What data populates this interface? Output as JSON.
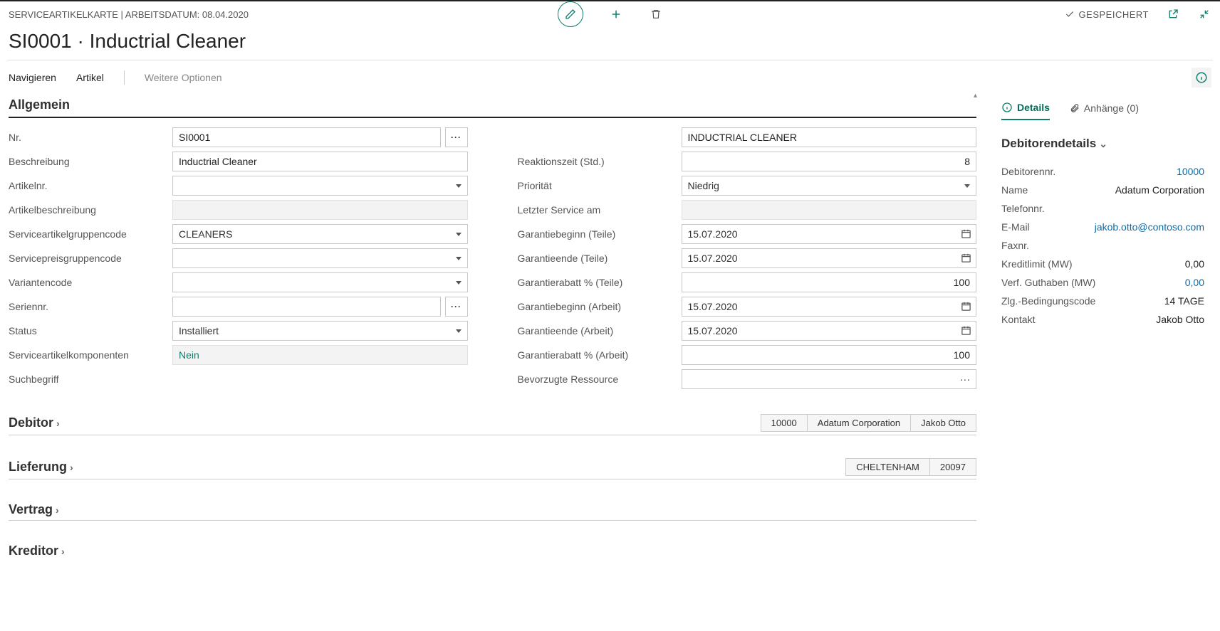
{
  "header": {
    "breadcrumb": "SERVICEARTIKELKARTE | ARBEITSDATUM: 08.04.2020",
    "saved_label": "GESPEICHERT",
    "title": "SI0001 · Inductrial Cleaner"
  },
  "menubar": {
    "navigieren": "Navigieren",
    "artikel": "Artikel",
    "weitere": "Weitere Optionen"
  },
  "general": {
    "title": "Allgemein",
    "labels": {
      "nr": "Nr.",
      "beschreibung": "Beschreibung",
      "artikelnr": "Artikelnr.",
      "artikelbeschreibung": "Artikelbeschreibung",
      "serviceartikelgruppencode": "Serviceartikelgruppencode",
      "servicepreisgruppencode": "Servicepreisgruppencode",
      "variantencode": "Variantencode",
      "seriennr": "Seriennr.",
      "status": "Status",
      "serviceartikelkomponenten": "Serviceartikelkomponenten",
      "suchbegriff": "Suchbegriff",
      "blank": "",
      "reaktionszeit": "Reaktionszeit (Std.)",
      "prioritaet": "Priorität",
      "letzter_service": "Letzter Service am",
      "garantiebeginn_teile": "Garantiebeginn (Teile)",
      "garantieende_teile": "Garantieende (Teile)",
      "garantierabatt_teile": "Garantierabatt % (Teile)",
      "garantiebeginn_arbeit": "Garantiebeginn (Arbeit)",
      "garantieende_arbeit": "Garantieende (Arbeit)",
      "garantierabatt_arbeit": "Garantierabatt % (Arbeit)",
      "bevorzugte_ressource": "Bevorzugte Ressource"
    },
    "values": {
      "nr": "SI0001",
      "beschreibung": "Inductrial Cleaner",
      "artikelnr": "",
      "artikelbeschreibung": "",
      "serviceartikelgruppencode": "CLEANERS",
      "servicepreisgruppencode": "",
      "variantencode": "",
      "seriennr": "",
      "status": "Installiert",
      "serviceartikelkomponenten": "Nein",
      "suchbegriff": "",
      "suchbegriff_upper": "INDUCTRIAL CLEANER",
      "reaktionszeit": "8",
      "prioritaet": "Niedrig",
      "letzter_service": "",
      "garantiebeginn_teile": "15.07.2020",
      "garantieende_teile": "15.07.2020",
      "garantierabatt_teile": "100",
      "garantiebeginn_arbeit": "15.07.2020",
      "garantieende_arbeit": "15.07.2020",
      "garantierabatt_arbeit": "100",
      "bevorzugte_ressource": ""
    }
  },
  "fasttabs": {
    "debitor": {
      "title": "Debitor",
      "summary": [
        "10000",
        "Adatum Corporation",
        "Jakob Otto"
      ]
    },
    "lieferung": {
      "title": "Lieferung",
      "summary": [
        "CHELTENHAM",
        "20097"
      ]
    },
    "vertrag": {
      "title": "Vertrag"
    },
    "kreditor": {
      "title": "Kreditor"
    }
  },
  "factbox": {
    "tab_details": "Details",
    "tab_anhaenge": "Anhänge (0)",
    "section_title": "Debitorendetails",
    "rows": {
      "debitorennr": {
        "k": "Debitorennr.",
        "v": "10000",
        "link": true
      },
      "name": {
        "k": "Name",
        "v": "Adatum Corporation"
      },
      "telefonnr": {
        "k": "Telefonnr.",
        "v": ""
      },
      "email": {
        "k": "E-Mail",
        "v": "jakob.otto@contoso.com",
        "link": true
      },
      "faxnr": {
        "k": "Faxnr.",
        "v": ""
      },
      "kreditlimit": {
        "k": "Kreditlimit (MW)",
        "v": "0,00"
      },
      "verf_guthaben": {
        "k": "Verf. Guthaben (MW)",
        "v": "0,00",
        "link": true
      },
      "zlg": {
        "k": "Zlg.-Bedingungscode",
        "v": "14 TAGE"
      },
      "kontakt": {
        "k": "Kontakt",
        "v": "Jakob Otto"
      }
    }
  }
}
